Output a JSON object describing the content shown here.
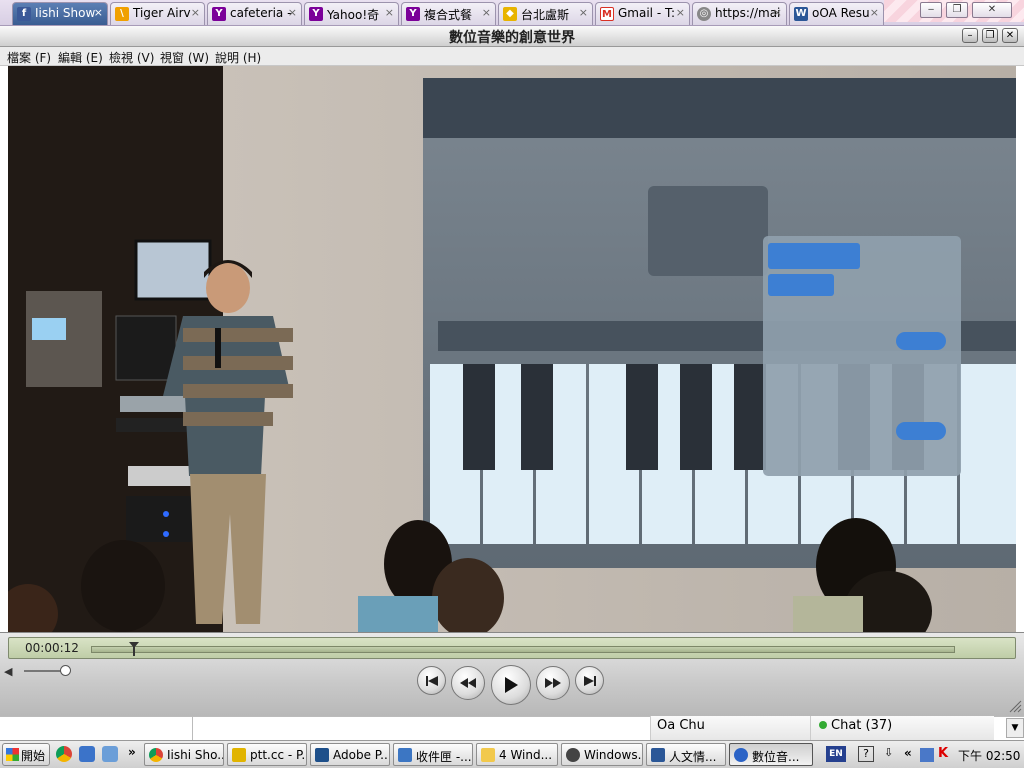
{
  "browser": {
    "tabs": [
      {
        "label": "Iishi Show",
        "icon": "facebook-icon",
        "active": true
      },
      {
        "label": "Tiger Airv",
        "icon": "tiger-icon"
      },
      {
        "label": "cafeteria -",
        "icon": "yahoo-icon"
      },
      {
        "label": "Yahoo!奇",
        "icon": "yahoo-icon"
      },
      {
        "label": "複合式餐",
        "icon": "yahoo-icon"
      },
      {
        "label": "台北盧斯",
        "icon": "map-icon"
      },
      {
        "label": "Gmail - T:",
        "icon": "gmail-icon"
      },
      {
        "label": "https://mai",
        "icon": "globe-icon"
      },
      {
        "label": "oOA Resu",
        "icon": "word-icon"
      }
    ]
  },
  "player": {
    "title": "數位音樂的創意世界",
    "menu": [
      "檔案 (F)",
      "編輯 (E)",
      "檢視 (V)",
      "視窗 (W)",
      "說明 (H)"
    ],
    "time": "00:00:12",
    "progress": 0.05
  },
  "status": {
    "contact": "Oa Chu",
    "chat": "Chat (37)"
  },
  "taskbar": {
    "start": "開始",
    "items": [
      {
        "label": "Iishi Sho...",
        "icon": "chrome-icon"
      },
      {
        "label": "ptt.cc - P...",
        "icon": "pcman-icon"
      },
      {
        "label": "Adobe P...",
        "icon": "photoshop-icon"
      },
      {
        "label": "收件匣 -...",
        "icon": "outlook-icon"
      },
      {
        "label": "4  Wind...",
        "icon": "folder-icon"
      },
      {
        "label": "Windows...",
        "icon": "media-player-icon"
      },
      {
        "label": "人文情...",
        "icon": "word-icon"
      },
      {
        "label": "數位音...",
        "icon": "quicktime-icon",
        "active": true
      }
    ],
    "lang": "EN",
    "clock": "下午 02:50"
  },
  "colors": {
    "facebook": "#3b5998",
    "yahoo": "#7b0099",
    "gmail": "#d93025",
    "quicktime_blue": "#2b63c6",
    "tab_active": "#3a5d92"
  }
}
